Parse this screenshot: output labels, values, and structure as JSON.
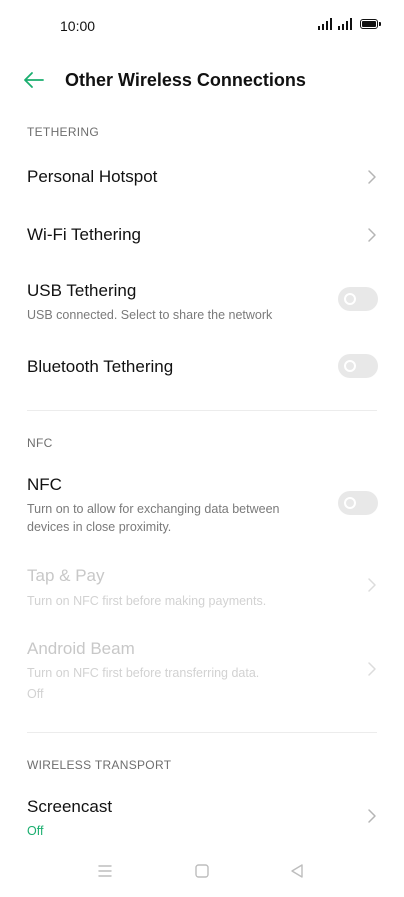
{
  "status_bar": {
    "time": "10:00"
  },
  "header": {
    "title": "Other Wireless Connections",
    "back_icon": "arrow-left-icon"
  },
  "sections": {
    "tethering": {
      "header": "TETHERING",
      "personal_hotspot": {
        "title": "Personal Hotspot"
      },
      "wifi_tethering": {
        "title": "Wi-Fi Tethering"
      },
      "usb_tethering": {
        "title": "USB Tethering",
        "subtitle": "USB connected. Select to share the network",
        "enabled": false
      },
      "bluetooth_tethering": {
        "title": "Bluetooth Tethering",
        "enabled": false
      }
    },
    "nfc": {
      "header": "NFC",
      "nfc": {
        "title": "NFC",
        "subtitle_1": "Turn on to allow for exchanging data between",
        "subtitle_2": "devices in close proximity.",
        "enabled": false
      },
      "tap_pay": {
        "title": "Tap & Pay",
        "subtitle": "Turn on NFC first before making payments."
      },
      "android_beam": {
        "title": "Android Beam",
        "subtitle": "Turn on NFC first before transferring data.",
        "status": "Off"
      }
    },
    "wireless_transport": {
      "header": "WIRELESS TRANSPORT",
      "screencast": {
        "title": "Screencast",
        "status": "Off"
      }
    }
  },
  "colors": {
    "accent": "#1aae6f",
    "toggle_off": "#e8e8e8",
    "disabled_text": "#c8c8c8"
  }
}
